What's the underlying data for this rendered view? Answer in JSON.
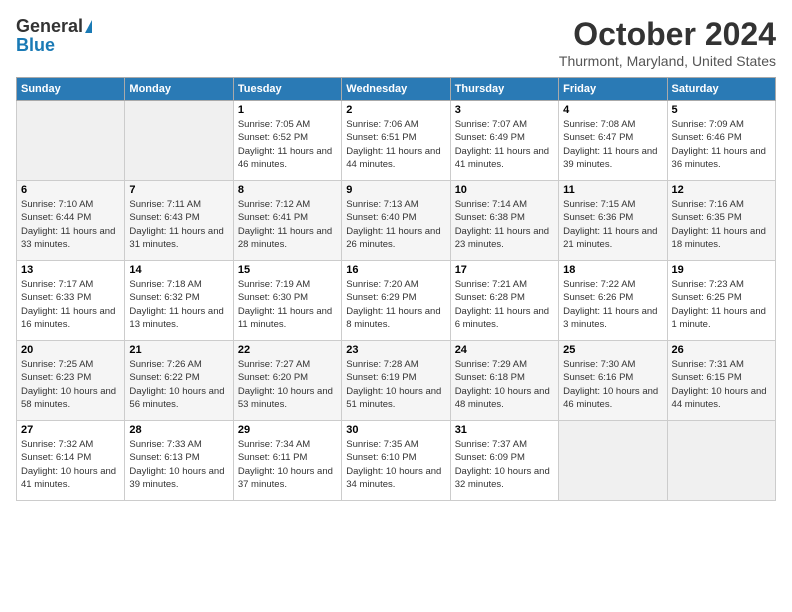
{
  "header": {
    "logo_general": "General",
    "logo_blue": "Blue",
    "month_title": "October 2024",
    "location": "Thurmont, Maryland, United States"
  },
  "days_of_week": [
    "Sunday",
    "Monday",
    "Tuesday",
    "Wednesday",
    "Thursday",
    "Friday",
    "Saturday"
  ],
  "weeks": [
    [
      {
        "day": "",
        "empty": true
      },
      {
        "day": "",
        "empty": true
      },
      {
        "day": "1",
        "sunrise": "Sunrise: 7:05 AM",
        "sunset": "Sunset: 6:52 PM",
        "daylight": "Daylight: 11 hours and 46 minutes."
      },
      {
        "day": "2",
        "sunrise": "Sunrise: 7:06 AM",
        "sunset": "Sunset: 6:51 PM",
        "daylight": "Daylight: 11 hours and 44 minutes."
      },
      {
        "day": "3",
        "sunrise": "Sunrise: 7:07 AM",
        "sunset": "Sunset: 6:49 PM",
        "daylight": "Daylight: 11 hours and 41 minutes."
      },
      {
        "day": "4",
        "sunrise": "Sunrise: 7:08 AM",
        "sunset": "Sunset: 6:47 PM",
        "daylight": "Daylight: 11 hours and 39 minutes."
      },
      {
        "day": "5",
        "sunrise": "Sunrise: 7:09 AM",
        "sunset": "Sunset: 6:46 PM",
        "daylight": "Daylight: 11 hours and 36 minutes."
      }
    ],
    [
      {
        "day": "6",
        "sunrise": "Sunrise: 7:10 AM",
        "sunset": "Sunset: 6:44 PM",
        "daylight": "Daylight: 11 hours and 33 minutes."
      },
      {
        "day": "7",
        "sunrise": "Sunrise: 7:11 AM",
        "sunset": "Sunset: 6:43 PM",
        "daylight": "Daylight: 11 hours and 31 minutes."
      },
      {
        "day": "8",
        "sunrise": "Sunrise: 7:12 AM",
        "sunset": "Sunset: 6:41 PM",
        "daylight": "Daylight: 11 hours and 28 minutes."
      },
      {
        "day": "9",
        "sunrise": "Sunrise: 7:13 AM",
        "sunset": "Sunset: 6:40 PM",
        "daylight": "Daylight: 11 hours and 26 minutes."
      },
      {
        "day": "10",
        "sunrise": "Sunrise: 7:14 AM",
        "sunset": "Sunset: 6:38 PM",
        "daylight": "Daylight: 11 hours and 23 minutes."
      },
      {
        "day": "11",
        "sunrise": "Sunrise: 7:15 AM",
        "sunset": "Sunset: 6:36 PM",
        "daylight": "Daylight: 11 hours and 21 minutes."
      },
      {
        "day": "12",
        "sunrise": "Sunrise: 7:16 AM",
        "sunset": "Sunset: 6:35 PM",
        "daylight": "Daylight: 11 hours and 18 minutes."
      }
    ],
    [
      {
        "day": "13",
        "sunrise": "Sunrise: 7:17 AM",
        "sunset": "Sunset: 6:33 PM",
        "daylight": "Daylight: 11 hours and 16 minutes."
      },
      {
        "day": "14",
        "sunrise": "Sunrise: 7:18 AM",
        "sunset": "Sunset: 6:32 PM",
        "daylight": "Daylight: 11 hours and 13 minutes."
      },
      {
        "day": "15",
        "sunrise": "Sunrise: 7:19 AM",
        "sunset": "Sunset: 6:30 PM",
        "daylight": "Daylight: 11 hours and 11 minutes."
      },
      {
        "day": "16",
        "sunrise": "Sunrise: 7:20 AM",
        "sunset": "Sunset: 6:29 PM",
        "daylight": "Daylight: 11 hours and 8 minutes."
      },
      {
        "day": "17",
        "sunrise": "Sunrise: 7:21 AM",
        "sunset": "Sunset: 6:28 PM",
        "daylight": "Daylight: 11 hours and 6 minutes."
      },
      {
        "day": "18",
        "sunrise": "Sunrise: 7:22 AM",
        "sunset": "Sunset: 6:26 PM",
        "daylight": "Daylight: 11 hours and 3 minutes."
      },
      {
        "day": "19",
        "sunrise": "Sunrise: 7:23 AM",
        "sunset": "Sunset: 6:25 PM",
        "daylight": "Daylight: 11 hours and 1 minute."
      }
    ],
    [
      {
        "day": "20",
        "sunrise": "Sunrise: 7:25 AM",
        "sunset": "Sunset: 6:23 PM",
        "daylight": "Daylight: 10 hours and 58 minutes."
      },
      {
        "day": "21",
        "sunrise": "Sunrise: 7:26 AM",
        "sunset": "Sunset: 6:22 PM",
        "daylight": "Daylight: 10 hours and 56 minutes."
      },
      {
        "day": "22",
        "sunrise": "Sunrise: 7:27 AM",
        "sunset": "Sunset: 6:20 PM",
        "daylight": "Daylight: 10 hours and 53 minutes."
      },
      {
        "day": "23",
        "sunrise": "Sunrise: 7:28 AM",
        "sunset": "Sunset: 6:19 PM",
        "daylight": "Daylight: 10 hours and 51 minutes."
      },
      {
        "day": "24",
        "sunrise": "Sunrise: 7:29 AM",
        "sunset": "Sunset: 6:18 PM",
        "daylight": "Daylight: 10 hours and 48 minutes."
      },
      {
        "day": "25",
        "sunrise": "Sunrise: 7:30 AM",
        "sunset": "Sunset: 6:16 PM",
        "daylight": "Daylight: 10 hours and 46 minutes."
      },
      {
        "day": "26",
        "sunrise": "Sunrise: 7:31 AM",
        "sunset": "Sunset: 6:15 PM",
        "daylight": "Daylight: 10 hours and 44 minutes."
      }
    ],
    [
      {
        "day": "27",
        "sunrise": "Sunrise: 7:32 AM",
        "sunset": "Sunset: 6:14 PM",
        "daylight": "Daylight: 10 hours and 41 minutes."
      },
      {
        "day": "28",
        "sunrise": "Sunrise: 7:33 AM",
        "sunset": "Sunset: 6:13 PM",
        "daylight": "Daylight: 10 hours and 39 minutes."
      },
      {
        "day": "29",
        "sunrise": "Sunrise: 7:34 AM",
        "sunset": "Sunset: 6:11 PM",
        "daylight": "Daylight: 10 hours and 37 minutes."
      },
      {
        "day": "30",
        "sunrise": "Sunrise: 7:35 AM",
        "sunset": "Sunset: 6:10 PM",
        "daylight": "Daylight: 10 hours and 34 minutes."
      },
      {
        "day": "31",
        "sunrise": "Sunrise: 7:37 AM",
        "sunset": "Sunset: 6:09 PM",
        "daylight": "Daylight: 10 hours and 32 minutes."
      },
      {
        "day": "",
        "empty": true
      },
      {
        "day": "",
        "empty": true
      }
    ]
  ]
}
